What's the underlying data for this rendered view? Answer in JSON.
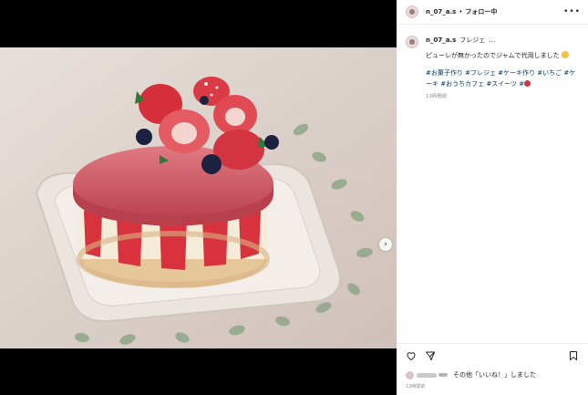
{
  "header": {
    "username": "n_07_a.s",
    "separator": "•",
    "follow_status": "フォロー中",
    "more_icon": "more-horizontal-icon"
  },
  "caption": {
    "username": "n_07_a.s",
    "title": "フレジェ",
    "title_suffix": "…",
    "text": "ピューレが無かったのでジャムで代用しました",
    "hashtags": "#お菓子作り #フレジェ #ケーキ作り #いちご #ケーキ #おうちカフェ #スイーツ #",
    "time": "13時間前"
  },
  "actions": {
    "like_icon": "heart-icon",
    "share_icon": "send-icon",
    "save_icon": "bookmark-icon"
  },
  "likes": {
    "text": "その他「いいね！」しました",
    "prefix": "その他"
  },
  "post_time": "13時間前",
  "media": {
    "next_icon": "chevron-right-icon",
    "next_glyph": "›",
    "description_colors": {
      "background": "#d9cdc6",
      "jelly": "#c9535e",
      "strawberry": "#d8323c"
    }
  }
}
